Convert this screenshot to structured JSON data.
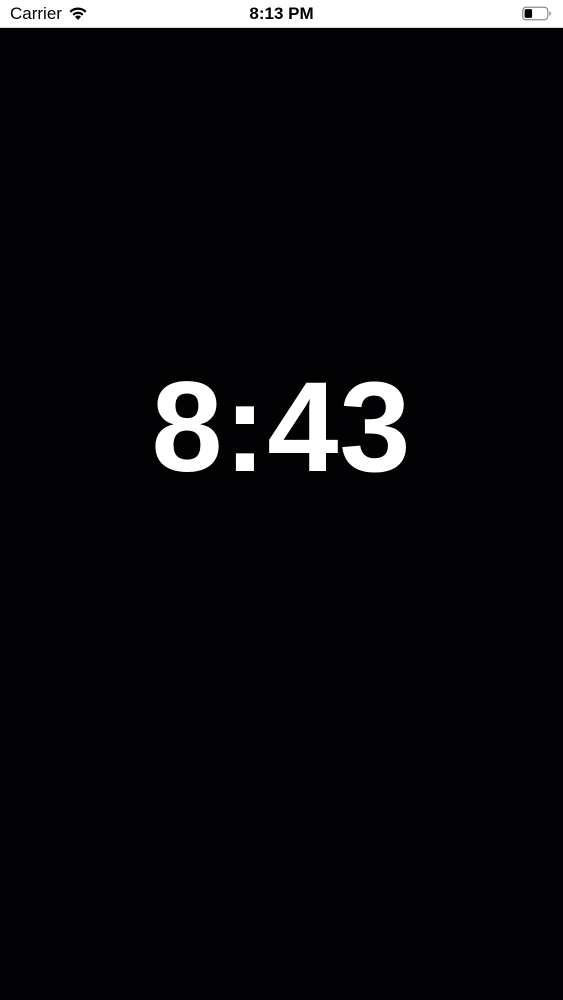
{
  "status_bar": {
    "carrier": "Carrier",
    "time": "8:13 PM",
    "wifi_icon": "wifi-icon",
    "battery_icon": "battery-icon",
    "battery_level": 0.35
  },
  "main": {
    "time_display": "8:43"
  },
  "colors": {
    "background": "#020104",
    "text": "#ffffff",
    "status_bar_background": "#ffffff"
  }
}
